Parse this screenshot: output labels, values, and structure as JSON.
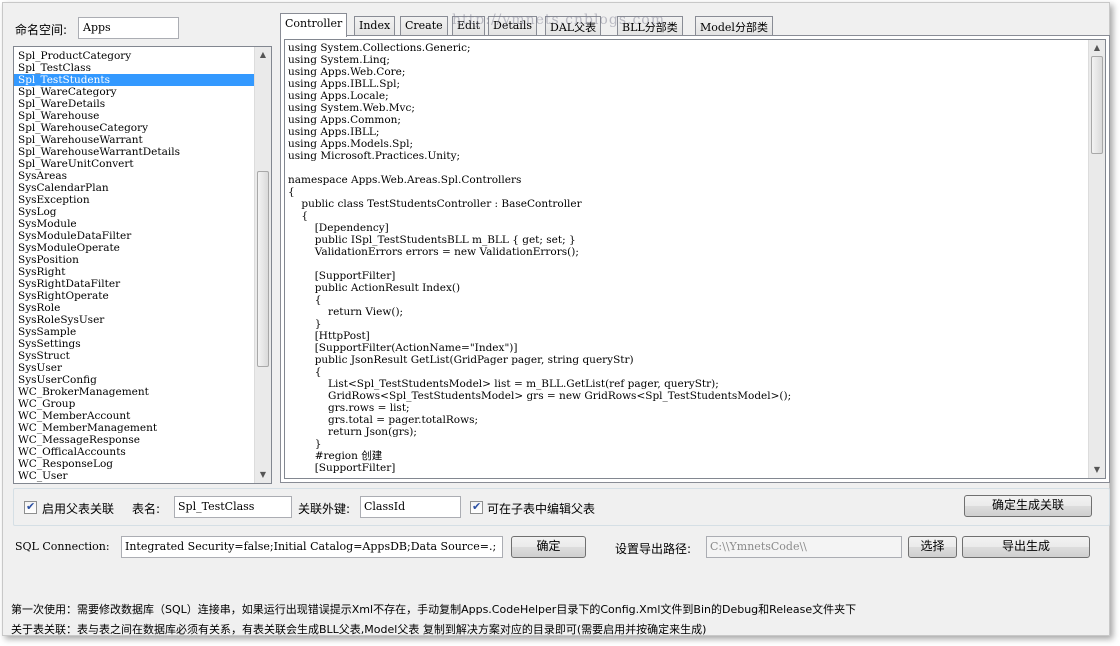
{
  "namespace": {
    "label": "命名空间:",
    "value": "Apps"
  },
  "tables": {
    "items": [
      "Spl_ProductCategory",
      "Spl_TestClass",
      "Spl_TestStudents",
      "Spl_WareCategory",
      "Spl_WareDetails",
      "Spl_Warehouse",
      "Spl_WarehouseCategory",
      "Spl_WarehouseWarrant",
      "Spl_WarehouseWarrantDetails",
      "Spl_WareUnitConvert",
      "SysAreas",
      "SysCalendarPlan",
      "SysException",
      "SysLog",
      "SysModule",
      "SysModuleDataFilter",
      "SysModuleOperate",
      "SysPosition",
      "SysRight",
      "SysRightDataFilter",
      "SysRightOperate",
      "SysRole",
      "SysRoleSysUser",
      "SysSample",
      "SysSettings",
      "SysStruct",
      "SysUser",
      "SysUserConfig",
      "WC_BrokerManagement",
      "WC_Group",
      "WC_MemberAccount",
      "WC_MemberManagement",
      "WC_MessageResponse",
      "WC_OfficalAccounts",
      "WC_ResponseLog",
      "WC_User"
    ],
    "selected": "Spl_TestStudents",
    "scroll_fraction": 0.52
  },
  "tabs": [
    {
      "label": "Controller",
      "active": true
    },
    {
      "label": "Index",
      "active": false
    },
    {
      "label": "Create",
      "active": false
    },
    {
      "label": "Edit",
      "active": false
    },
    {
      "label": "Details",
      "active": false
    },
    {
      "label": "DAL父表",
      "active": false
    },
    {
      "label": "BLL分部类",
      "active": false
    },
    {
      "label": "Model分部类",
      "active": false
    }
  ],
  "watermark": "http://ymnets.cnblogs.com",
  "code_lines": [
    "using System.Collections.Generic;",
    "using System.Linq;",
    "using Apps.Web.Core;",
    "using Apps.IBLL.Spl;",
    "using Apps.Locale;",
    "using System.Web.Mvc;",
    "using Apps.Common;",
    "using Apps.IBLL;",
    "using Apps.Models.Spl;",
    "using Microsoft.Practices.Unity;",
    "",
    "namespace Apps.Web.Areas.Spl.Controllers",
    "{",
    "    public class TestStudentsController : BaseController",
    "    {",
    "        [Dependency]",
    "        public ISpl_TestStudentsBLL m_BLL { get; set; }",
    "        ValidationErrors errors = new ValidationErrors();",
    "",
    "        [SupportFilter]",
    "        public ActionResult Index()",
    "        {",
    "            return View();",
    "        }",
    "        [HttpPost]",
    "        [SupportFilter(ActionName=\"Index\")]",
    "        public JsonResult GetList(GridPager pager, string queryStr)",
    "        {",
    "            List<Spl_TestStudentsModel> list = m_BLL.GetList(ref pager, queryStr);",
    "            GridRows<Spl_TestStudentsModel> grs = new GridRows<Spl_TestStudentsModel>();",
    "            grs.rows = list;",
    "            grs.total = pager.totalRows;",
    "            return Json(grs);",
    "        }",
    "        #region 创建",
    "        [SupportFilter]"
  ],
  "code_scroll_fraction": 0.0,
  "relation": {
    "enable_label": "启用父表关联",
    "enable_checked": true,
    "table_label": "表名:",
    "table_value": "Spl_TestClass",
    "fk_label": "关联外键:",
    "fk_value": "ClassId",
    "edit_parent_label": "可在子表中编辑父表",
    "edit_parent_checked": true,
    "confirm_button": "确定生成关联"
  },
  "sql": {
    "label": "SQL Connection:",
    "value": "Integrated Security=false;Initial Catalog=AppsDB;Data Source=.;",
    "ok_button": "确定"
  },
  "export": {
    "label": "设置导出路径:",
    "path": "C:\\\\YmnetsCode\\\\",
    "choose_button": "选择",
    "generate_button": "导出生成"
  },
  "notes": [
    "第一次使用：需要修改数据库（SQL）连接串，如果运行出现错误提示Xml不存在，手动复制Apps.CodeHelper目录下的Config.Xml文件到Bin的Debug和Release文件夹下",
    "关于表关联：表与表之间在数据库必须有关系，有表关联会生成BLL父表,Model父表 复制到解决方案对应的目录即可(需要启用并按确定来生成)"
  ]
}
